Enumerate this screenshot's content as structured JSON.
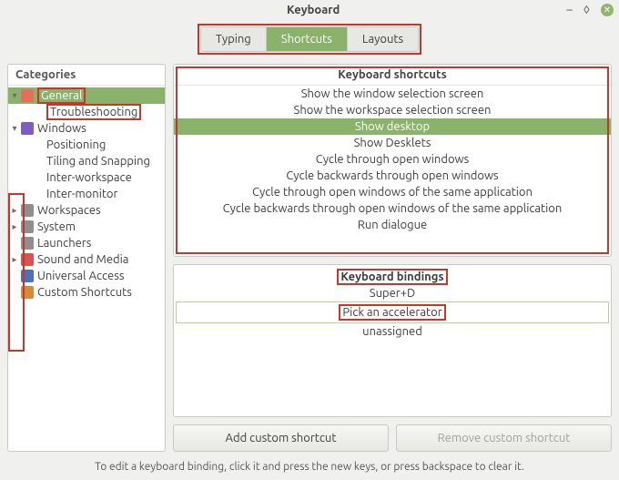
{
  "window": {
    "title": "Keyboard"
  },
  "tabs": {
    "typing": "Typing",
    "shortcuts": "Shortcuts",
    "layouts": "Layouts"
  },
  "sidebar": {
    "title": "Categories",
    "items": [
      {
        "label": "General",
        "depth": 0,
        "expander": "▾",
        "icon": "gear-icon",
        "color": "#e36f5f",
        "selected": true,
        "hl": true
      },
      {
        "label": "Troubleshooting",
        "depth": 1,
        "expander": "",
        "icon": "",
        "color": "",
        "selected": false,
        "hl": true
      },
      {
        "label": "Windows",
        "depth": 0,
        "expander": "▾",
        "icon": "windows-icon",
        "color": "#7a5fc0",
        "selected": false,
        "hl": false
      },
      {
        "label": "Positioning",
        "depth": 1,
        "expander": "",
        "icon": "",
        "color": "",
        "selected": false,
        "hl": false
      },
      {
        "label": "Tiling and Snapping",
        "depth": 1,
        "expander": "",
        "icon": "",
        "color": "",
        "selected": false,
        "hl": false
      },
      {
        "label": "Inter-workspace",
        "depth": 1,
        "expander": "",
        "icon": "",
        "color": "",
        "selected": false,
        "hl": false
      },
      {
        "label": "Inter-monitor",
        "depth": 1,
        "expander": "",
        "icon": "",
        "color": "",
        "selected": false,
        "hl": false
      },
      {
        "label": "Workspaces",
        "depth": 0,
        "expander": "▸",
        "icon": "workspaces-icon",
        "color": "#8f8f8f",
        "selected": false,
        "hl": false
      },
      {
        "label": "System",
        "depth": 0,
        "expander": "▸",
        "icon": "system-icon",
        "color": "#8f8f8f",
        "selected": false,
        "hl": false
      },
      {
        "label": "Launchers",
        "depth": 0,
        "expander": "",
        "icon": "launchers-icon",
        "color": "#8f8f8f",
        "selected": false,
        "hl": false
      },
      {
        "label": "Sound and Media",
        "depth": 0,
        "expander": "▸",
        "icon": "media-icon",
        "color": "#d9534f",
        "selected": false,
        "hl": false
      },
      {
        "label": "Universal Access",
        "depth": 0,
        "expander": "",
        "icon": "access-icon",
        "color": "#4a70b8",
        "selected": false,
        "hl": false
      },
      {
        "label": "Custom Shortcuts",
        "depth": 0,
        "expander": "",
        "icon": "custom-icon",
        "color": "#d58a3a",
        "selected": false,
        "hl": false
      }
    ]
  },
  "shortcuts": {
    "title": "Keyboard shortcuts",
    "rows": [
      "Show the window selection screen",
      "Show the workspace selection screen",
      "Show desktop",
      "Show Desklets",
      "Cycle through open windows",
      "Cycle backwards through open windows",
      "Cycle through open windows of the same application",
      "Cycle backwards through open windows of the same application",
      "Run dialogue"
    ],
    "selected_index": 2
  },
  "bindings": {
    "title": "Keyboard bindings",
    "rows": [
      "Super+D",
      "Pick an accelerator",
      "unassigned"
    ],
    "selected_index": 1
  },
  "buttons": {
    "add": "Add custom shortcut",
    "remove": "Remove custom shortcut"
  },
  "hint": "To edit a keyboard binding, click it and press the new keys, or press backspace to clear it."
}
